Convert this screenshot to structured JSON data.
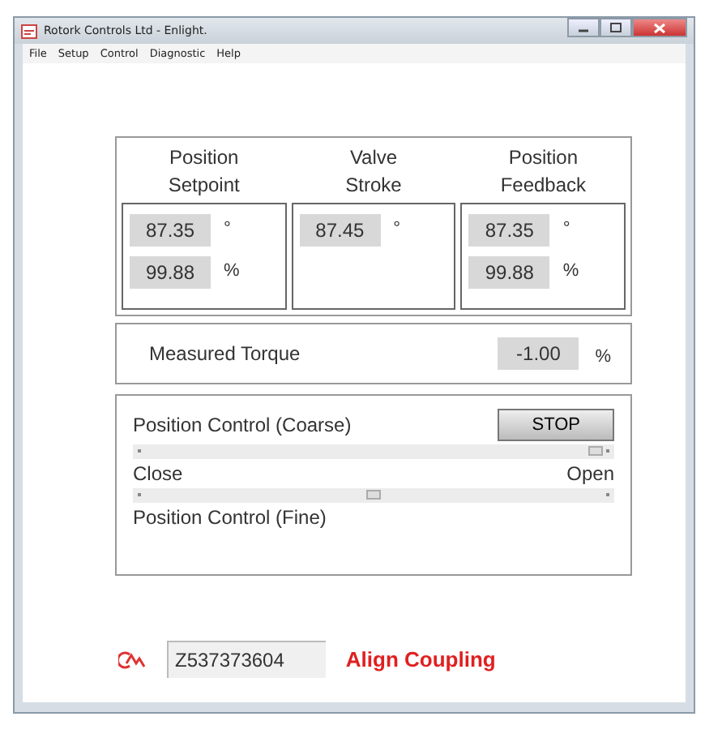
{
  "window": {
    "title": "Rotork Controls Ltd - Enlight."
  },
  "menu": [
    "File",
    "Setup",
    "Control",
    "Diagnostic",
    "Help"
  ],
  "columns": [
    {
      "heading": [
        "Position",
        "Setpoint"
      ],
      "readings": [
        {
          "value": "87.35",
          "unit": "°"
        },
        {
          "value": "99.88",
          "unit": "%"
        }
      ]
    },
    {
      "heading": [
        "Valve",
        "Stroke"
      ],
      "readings": [
        {
          "value": "87.45",
          "unit": "°"
        }
      ]
    },
    {
      "heading": [
        "Position",
        "Feedback"
      ],
      "readings": [
        {
          "value": "87.35",
          "unit": "°"
        },
        {
          "value": "99.88",
          "unit": "%"
        }
      ]
    }
  ],
  "torque": {
    "label": "Measured Torque",
    "value": "-1.00",
    "unit": "%"
  },
  "control": {
    "coarse_label": "Position Control (Coarse)",
    "stop_button": "STOP",
    "coarse_slider": {
      "level": 0.97
    },
    "close_label": "Close",
    "open_label": "Open",
    "fine_slider": {
      "level": 0.5
    },
    "fine_label": "Position Control (Fine)"
  },
  "footer": {
    "serial": "Z537373604",
    "status": "Align Coupling"
  }
}
